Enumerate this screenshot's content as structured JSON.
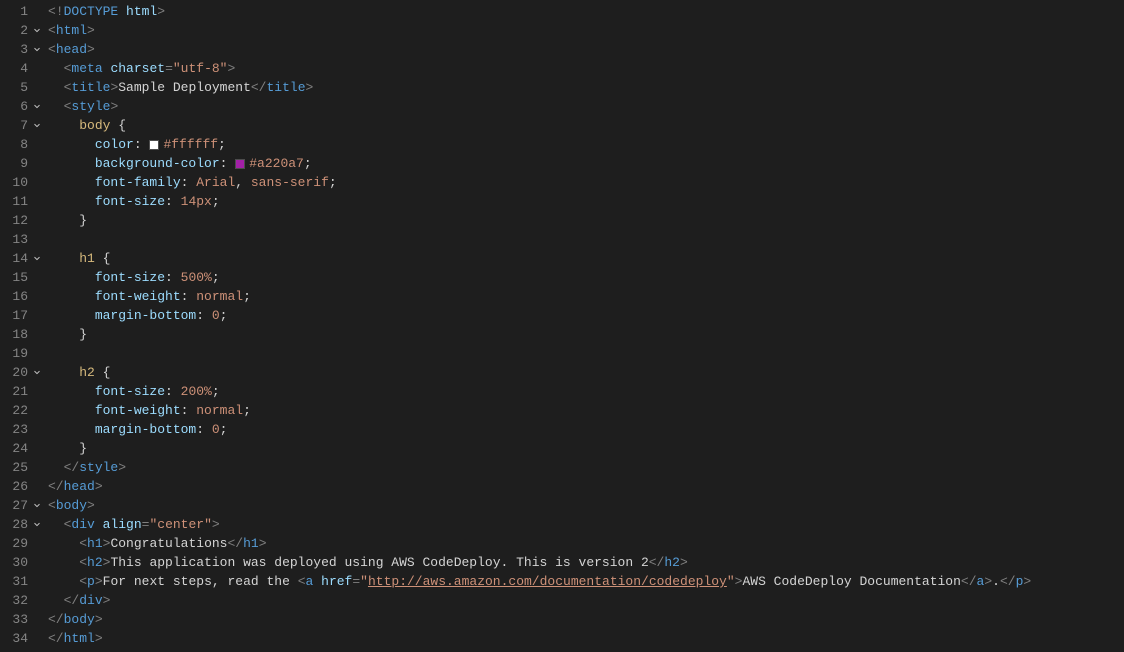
{
  "editor": {
    "lineCount": 34,
    "foldableLines": [
      2,
      3,
      6,
      7,
      14,
      20,
      27,
      28
    ],
    "colorSwatches": {
      "8": "#ffffff",
      "9": "#a220a7"
    },
    "lines": [
      [
        [
          "t-punc",
          "<!"
        ],
        [
          "t-tag",
          "DOCTYPE"
        ],
        [
          "t-text",
          " "
        ],
        [
          "t-attr",
          "html"
        ],
        [
          "t-punc",
          ">"
        ]
      ],
      [
        [
          "t-punc",
          "<"
        ],
        [
          "t-tag",
          "html"
        ],
        [
          "t-punc",
          ">"
        ]
      ],
      [
        [
          "t-punc",
          "<"
        ],
        [
          "t-tag",
          "head"
        ],
        [
          "t-punc",
          ">"
        ]
      ],
      [
        [
          "t-text",
          "  "
        ],
        [
          "t-punc",
          "<"
        ],
        [
          "t-tag",
          "meta"
        ],
        [
          "t-text",
          " "
        ],
        [
          "t-attr",
          "charset"
        ],
        [
          "t-punc",
          "="
        ],
        [
          "t-str",
          "\"utf-8\""
        ],
        [
          "t-punc",
          ">"
        ]
      ],
      [
        [
          "t-text",
          "  "
        ],
        [
          "t-punc",
          "<"
        ],
        [
          "t-tag",
          "title"
        ],
        [
          "t-punc",
          ">"
        ],
        [
          "t-text",
          "Sample Deployment"
        ],
        [
          "t-punc",
          "</"
        ],
        [
          "t-tag",
          "title"
        ],
        [
          "t-punc",
          ">"
        ]
      ],
      [
        [
          "t-text",
          "  "
        ],
        [
          "t-punc",
          "<"
        ],
        [
          "t-tag",
          "style"
        ],
        [
          "t-punc",
          ">"
        ]
      ],
      [
        [
          "t-text",
          "    "
        ],
        [
          "t-sel",
          "body"
        ],
        [
          "t-text",
          " {"
        ]
      ],
      [
        [
          "t-text",
          "      "
        ],
        [
          "t-prop",
          "color"
        ],
        [
          "t-text",
          ": "
        ],
        [
          "swatch",
          ""
        ],
        [
          "t-val",
          "#ffffff"
        ],
        [
          "t-text",
          ";"
        ]
      ],
      [
        [
          "t-text",
          "      "
        ],
        [
          "t-prop",
          "background-color"
        ],
        [
          "t-text",
          ": "
        ],
        [
          "swatch",
          ""
        ],
        [
          "t-val",
          "#a220a7"
        ],
        [
          "t-text",
          ";"
        ]
      ],
      [
        [
          "t-text",
          "      "
        ],
        [
          "t-prop",
          "font-family"
        ],
        [
          "t-text",
          ": "
        ],
        [
          "t-val",
          "Arial"
        ],
        [
          "t-text",
          ", "
        ],
        [
          "t-val",
          "sans-serif"
        ],
        [
          "t-text",
          ";"
        ]
      ],
      [
        [
          "t-text",
          "      "
        ],
        [
          "t-prop",
          "font-size"
        ],
        [
          "t-text",
          ": "
        ],
        [
          "t-val",
          "14px"
        ],
        [
          "t-text",
          ";"
        ]
      ],
      [
        [
          "t-text",
          "    }"
        ]
      ],
      [],
      [
        [
          "t-text",
          "    "
        ],
        [
          "t-sel",
          "h1"
        ],
        [
          "t-text",
          " {"
        ]
      ],
      [
        [
          "t-text",
          "      "
        ],
        [
          "t-prop",
          "font-size"
        ],
        [
          "t-text",
          ": "
        ],
        [
          "t-val",
          "500%"
        ],
        [
          "t-text",
          ";"
        ]
      ],
      [
        [
          "t-text",
          "      "
        ],
        [
          "t-prop",
          "font-weight"
        ],
        [
          "t-text",
          ": "
        ],
        [
          "t-val",
          "normal"
        ],
        [
          "t-text",
          ";"
        ]
      ],
      [
        [
          "t-text",
          "      "
        ],
        [
          "t-prop",
          "margin-bottom"
        ],
        [
          "t-text",
          ": "
        ],
        [
          "t-val",
          "0"
        ],
        [
          "t-text",
          ";"
        ]
      ],
      [
        [
          "t-text",
          "    }"
        ]
      ],
      [],
      [
        [
          "t-text",
          "    "
        ],
        [
          "t-sel",
          "h2"
        ],
        [
          "t-text",
          " {"
        ]
      ],
      [
        [
          "t-text",
          "      "
        ],
        [
          "t-prop",
          "font-size"
        ],
        [
          "t-text",
          ": "
        ],
        [
          "t-val",
          "200%"
        ],
        [
          "t-text",
          ";"
        ]
      ],
      [
        [
          "t-text",
          "      "
        ],
        [
          "t-prop",
          "font-weight"
        ],
        [
          "t-text",
          ": "
        ],
        [
          "t-val",
          "normal"
        ],
        [
          "t-text",
          ";"
        ]
      ],
      [
        [
          "t-text",
          "      "
        ],
        [
          "t-prop",
          "margin-bottom"
        ],
        [
          "t-text",
          ": "
        ],
        [
          "t-val",
          "0"
        ],
        [
          "t-text",
          ";"
        ]
      ],
      [
        [
          "t-text",
          "    }"
        ]
      ],
      [
        [
          "t-text",
          "  "
        ],
        [
          "t-punc",
          "</"
        ],
        [
          "t-tag",
          "style"
        ],
        [
          "t-punc",
          ">"
        ]
      ],
      [
        [
          "t-punc",
          "</"
        ],
        [
          "t-tag",
          "head"
        ],
        [
          "t-punc",
          ">"
        ]
      ],
      [
        [
          "t-punc",
          "<"
        ],
        [
          "t-tag",
          "body"
        ],
        [
          "t-punc",
          ">"
        ]
      ],
      [
        [
          "t-text",
          "  "
        ],
        [
          "t-punc",
          "<"
        ],
        [
          "t-tag",
          "div"
        ],
        [
          "t-text",
          " "
        ],
        [
          "t-attr",
          "align"
        ],
        [
          "t-punc",
          "="
        ],
        [
          "t-str",
          "\"center\""
        ],
        [
          "t-punc",
          ">"
        ]
      ],
      [
        [
          "t-text",
          "    "
        ],
        [
          "t-punc",
          "<"
        ],
        [
          "t-tag",
          "h1"
        ],
        [
          "t-punc",
          ">"
        ],
        [
          "t-text",
          "Congratulations"
        ],
        [
          "t-punc",
          "</"
        ],
        [
          "t-tag",
          "h1"
        ],
        [
          "t-punc",
          ">"
        ]
      ],
      [
        [
          "t-text",
          "    "
        ],
        [
          "t-punc",
          "<"
        ],
        [
          "t-tag",
          "h2"
        ],
        [
          "t-punc",
          ">"
        ],
        [
          "t-text",
          "This application was deployed using AWS CodeDeploy. This is version 2"
        ],
        [
          "t-punc",
          "</"
        ],
        [
          "t-tag",
          "h2"
        ],
        [
          "t-punc",
          ">"
        ]
      ],
      [
        [
          "t-text",
          "    "
        ],
        [
          "t-punc",
          "<"
        ],
        [
          "t-tag",
          "p"
        ],
        [
          "t-punc",
          ">"
        ],
        [
          "t-text",
          "For next steps, read the "
        ],
        [
          "t-punc",
          "<"
        ],
        [
          "t-tag",
          "a"
        ],
        [
          "t-text",
          " "
        ],
        [
          "t-attr",
          "href"
        ],
        [
          "t-punc",
          "="
        ],
        [
          "t-str",
          "\""
        ],
        [
          "t-link",
          "http://aws.amazon.com/documentation/codedeploy"
        ],
        [
          "t-str",
          "\""
        ],
        [
          "t-punc",
          ">"
        ],
        [
          "t-text",
          "AWS CodeDeploy Documentation"
        ],
        [
          "t-punc",
          "</"
        ],
        [
          "t-tag",
          "a"
        ],
        [
          "t-punc",
          ">"
        ],
        [
          "t-text",
          "."
        ],
        [
          "t-punc",
          "</"
        ],
        [
          "t-tag",
          "p"
        ],
        [
          "t-punc",
          ">"
        ]
      ],
      [
        [
          "t-text",
          "  "
        ],
        [
          "t-punc",
          "</"
        ],
        [
          "t-tag",
          "div"
        ],
        [
          "t-punc",
          ">"
        ]
      ],
      [
        [
          "t-punc",
          "</"
        ],
        [
          "t-tag",
          "body"
        ],
        [
          "t-punc",
          ">"
        ]
      ],
      [
        [
          "t-punc",
          "</"
        ],
        [
          "t-tag",
          "html"
        ],
        [
          "t-punc",
          ">"
        ]
      ]
    ]
  }
}
